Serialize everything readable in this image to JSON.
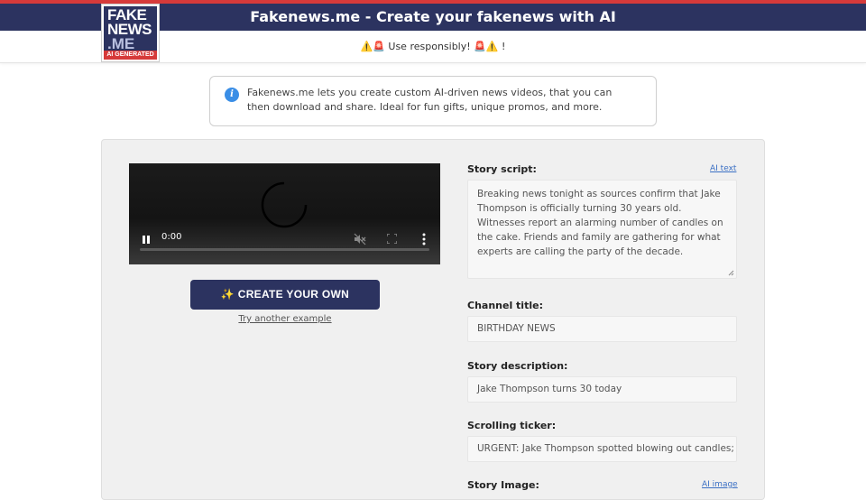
{
  "header": {
    "title": "Fakenews.me - Create your fakenews with AI",
    "logo": {
      "line1": "FAKE",
      "line2": "NEWS",
      "line3": ".ME",
      "tag": "AI GENERATED"
    },
    "warning": "⚠️🚨 Use responsibly! 🚨⚠️ !"
  },
  "info": {
    "text": "Fakenews.me lets you create custom AI-driven news videos, that you can then download and share. Ideal for fun gifts, unique promos, and more."
  },
  "video": {
    "time": "0:00",
    "state": "playing",
    "muted": true
  },
  "actions": {
    "create_label": "✨ CREATE YOUR OWN",
    "try_label": "Try another example"
  },
  "form": {
    "story_script": {
      "label": "Story script:",
      "ai_link": "AI text",
      "value": "Breaking news tonight as sources confirm that Jake Thompson is officially turning 30 years old. Witnesses report an alarming number of candles on the cake. Friends and family are gathering for what experts are calling the party of the decade."
    },
    "channel_title": {
      "label": "Channel title:",
      "value": "BIRTHDAY NEWS"
    },
    "story_description": {
      "label": "Story description:",
      "value": "Jake Thompson turns 30 today"
    },
    "scrolling_ticker": {
      "label": "Scrolling ticker:",
      "value": "URGENT: Jake Thompson spotted blowing out candles; wi"
    },
    "story_image": {
      "label": "Story Image:",
      "ai_link": "AI image"
    }
  },
  "colors": {
    "brand_navy": "#2c3360",
    "accent_red": "#d63a3a",
    "link_blue": "#3a6fc4"
  }
}
